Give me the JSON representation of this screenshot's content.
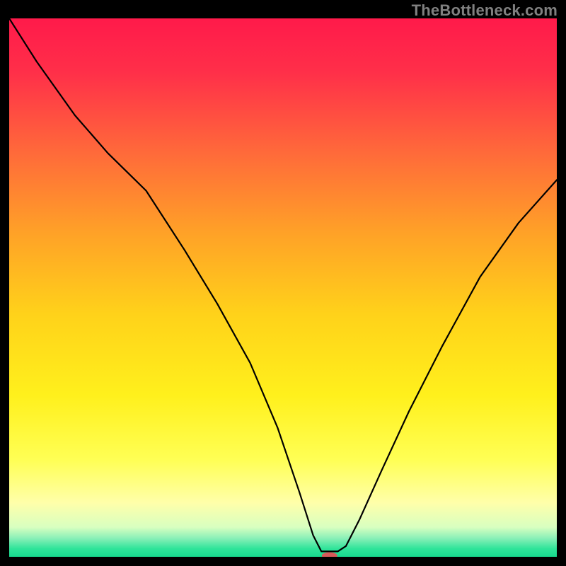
{
  "watermark": "TheBottleneck.com",
  "chart_data": {
    "type": "line",
    "title": "",
    "xlabel": "",
    "ylabel": "",
    "xlim": [
      0,
      100
    ],
    "ylim": [
      0,
      100
    ],
    "background_gradient": {
      "stops": [
        {
          "offset": 0.0,
          "color": "#ff1a4a"
        },
        {
          "offset": 0.1,
          "color": "#ff2f49"
        },
        {
          "offset": 0.25,
          "color": "#ff6a3a"
        },
        {
          "offset": 0.4,
          "color": "#ffa227"
        },
        {
          "offset": 0.55,
          "color": "#ffd21a"
        },
        {
          "offset": 0.7,
          "color": "#fff01c"
        },
        {
          "offset": 0.82,
          "color": "#ffff55"
        },
        {
          "offset": 0.9,
          "color": "#ffffaa"
        },
        {
          "offset": 0.945,
          "color": "#d8ffc0"
        },
        {
          "offset": 0.965,
          "color": "#8cf0b8"
        },
        {
          "offset": 0.985,
          "color": "#2fe49a"
        },
        {
          "offset": 1.0,
          "color": "#17d98e"
        }
      ]
    },
    "series": [
      {
        "name": "bottleneck-curve",
        "color": "#000000",
        "x": [
          0,
          5,
          12,
          18,
          25,
          32,
          38,
          44,
          49,
          53,
          55.5,
          57,
          60,
          61.5,
          64,
          68,
          73,
          79,
          86,
          93,
          100
        ],
        "y": [
          100,
          92,
          82,
          75,
          68,
          57,
          47,
          36,
          24,
          12,
          4,
          1,
          1,
          2,
          7,
          16,
          27,
          39,
          52,
          62,
          70
        ]
      }
    ],
    "marker": {
      "name": "optimal-point",
      "x": 58.5,
      "y": 0.2,
      "color": "#d65a5a",
      "rx": 11,
      "ry": 5
    }
  }
}
